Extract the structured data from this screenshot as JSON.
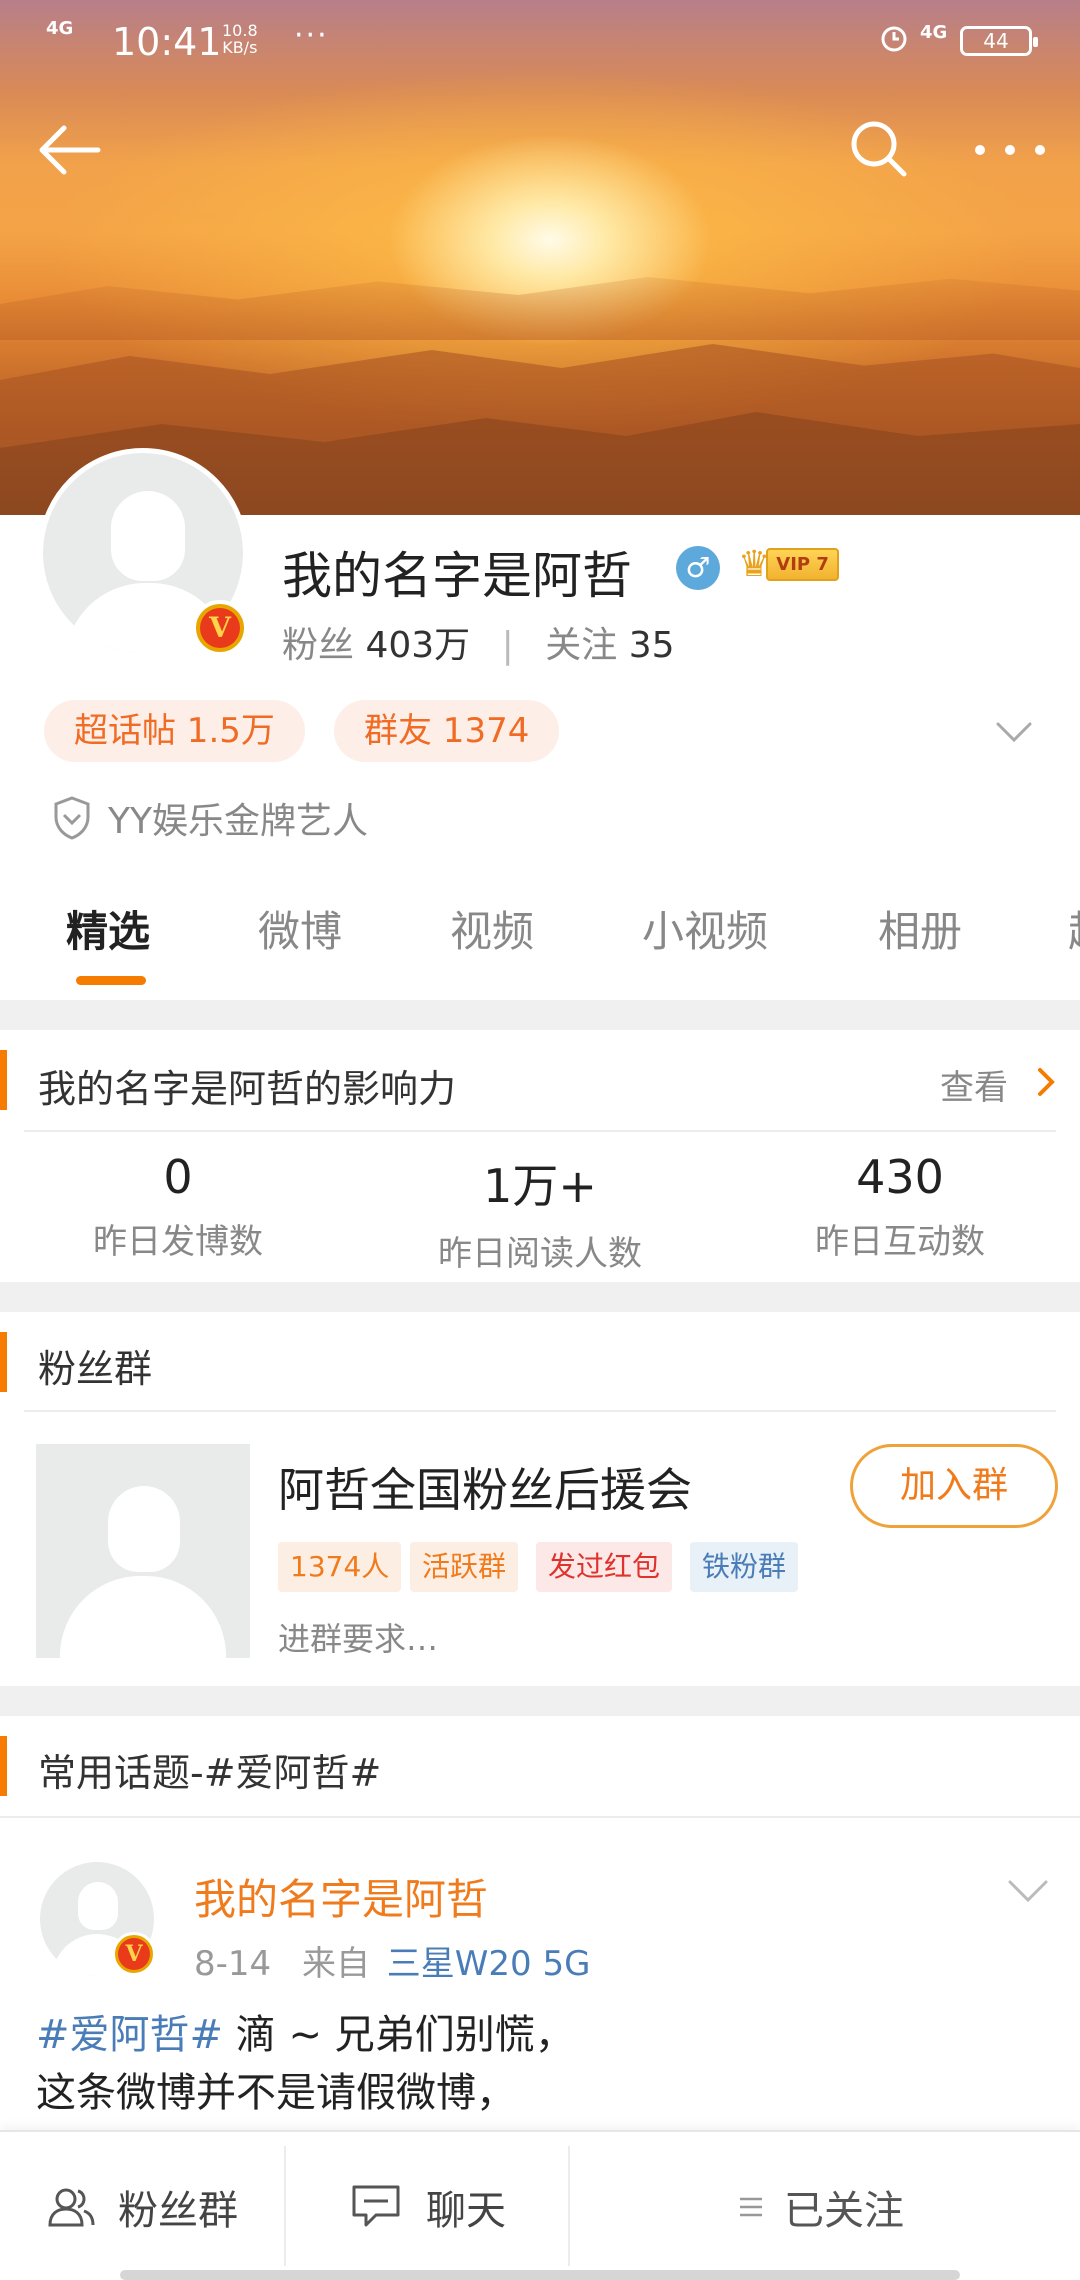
{
  "status_bar": {
    "network_left": "4G",
    "time": "10:41",
    "speed_value": "10.8",
    "speed_unit": "KB/s",
    "dots": "···",
    "network_right": "4G",
    "battery": "44"
  },
  "profile": {
    "name": "我的名字是阿哲",
    "gender_symbol": "♂",
    "vip_label": "VIP 7",
    "fans_label": "粉丝",
    "fans_value": "403万",
    "following_label": "关注",
    "following_value": "35",
    "separator": "|",
    "chips": [
      "超话帖 1.5万",
      "群友 1374"
    ],
    "certification": "YY娱乐金牌艺人"
  },
  "tabs": [
    "精选",
    "微博",
    "视频",
    "小视频",
    "相册",
    "超"
  ],
  "influence": {
    "title": "我的名字是阿哲的影响力",
    "view_label": "查看",
    "metrics": [
      {
        "value": "0",
        "label": "昨日发博数"
      },
      {
        "value": "1万+",
        "label": "昨日阅读人数"
      },
      {
        "value": "430",
        "label": "昨日互动数"
      }
    ]
  },
  "fan_group": {
    "title": "粉丝群",
    "name": "阿哲全国粉丝后援会",
    "join_label": "加入群",
    "tags": [
      {
        "text": "1374人",
        "color": "#f07b1d",
        "bg": "#fdeee4"
      },
      {
        "text": "活跃群",
        "color": "#f07b1d",
        "bg": "#fdeee4"
      },
      {
        "text": "发过红包",
        "color": "#e0322c",
        "bg": "#fde8e8"
      },
      {
        "text": "铁粉群",
        "color": "#4a7db8",
        "bg": "#e8f0f8"
      }
    ],
    "requirement": "进群要求…"
  },
  "topic_section": {
    "title": "常用话题-#爱阿哲#"
  },
  "post": {
    "author": "我的名字是阿哲",
    "date": "8-14",
    "from_label": "来自",
    "source": "三星W20 5G",
    "topic": "#爱阿哲#",
    "line1_rest": " 滴 ~ 兄弟们别慌，",
    "line2": "这条微博并不是请假微博，"
  },
  "bottom_bar": {
    "fan_group_label": "粉丝群",
    "chat_label": "聊天",
    "followed_label": "已关注"
  },
  "colors": {
    "accent": "#f57c00",
    "link": "#4a7db8",
    "orange_text": "#f07b1d"
  }
}
